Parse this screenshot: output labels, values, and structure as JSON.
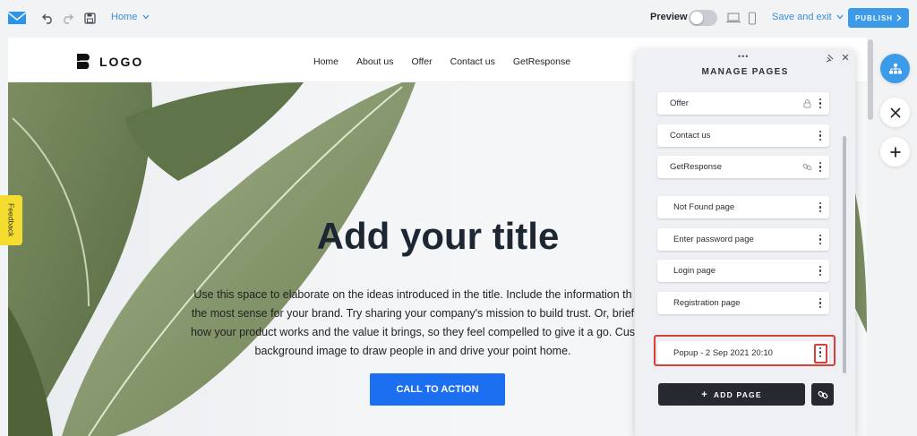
{
  "toolbar": {
    "home_label": "Home",
    "preview_label": "Preview",
    "save_exit_label": "Save and exit",
    "publish_label": "PUBLISH"
  },
  "site": {
    "logo_text": "LOGO",
    "nav": [
      "Home",
      "About us",
      "Offer",
      "Contact us",
      "GetResponse"
    ]
  },
  "hero": {
    "title": "Add your title",
    "text_lines": [
      "Use this space to elaborate on the ideas introduced in the title. Include the information th",
      "the most sense for your brand. Try sharing your company's mission to build trust. Or, brief",
      "how your product works and the value it brings, so they feel compelled to give it a go. Cus",
      "background image to draw people in and drive your point home."
    ],
    "cta_label": "CALL TO ACTION"
  },
  "feedback_label": "Feedback",
  "panel": {
    "title": "MANAGE PAGES",
    "pages": [
      {
        "label": "Offer",
        "icon": "lock-icon"
      },
      {
        "label": "Contact us",
        "icon": ""
      },
      {
        "label": "GetResponse",
        "icon": "link-icon"
      }
    ],
    "special_pages": [
      {
        "label": "Not Found page"
      },
      {
        "label": "Enter password page"
      },
      {
        "label": "Login page"
      },
      {
        "label": "Registration page"
      }
    ],
    "popup_label": "Popup - 2 Sep 2021 20:10",
    "add_page_label": "ADD PAGE"
  },
  "colors": {
    "accent": "#3b9be8",
    "cta": "#1b6ff0",
    "highlight": "#d9403a",
    "feedback": "#f4dd2f"
  }
}
